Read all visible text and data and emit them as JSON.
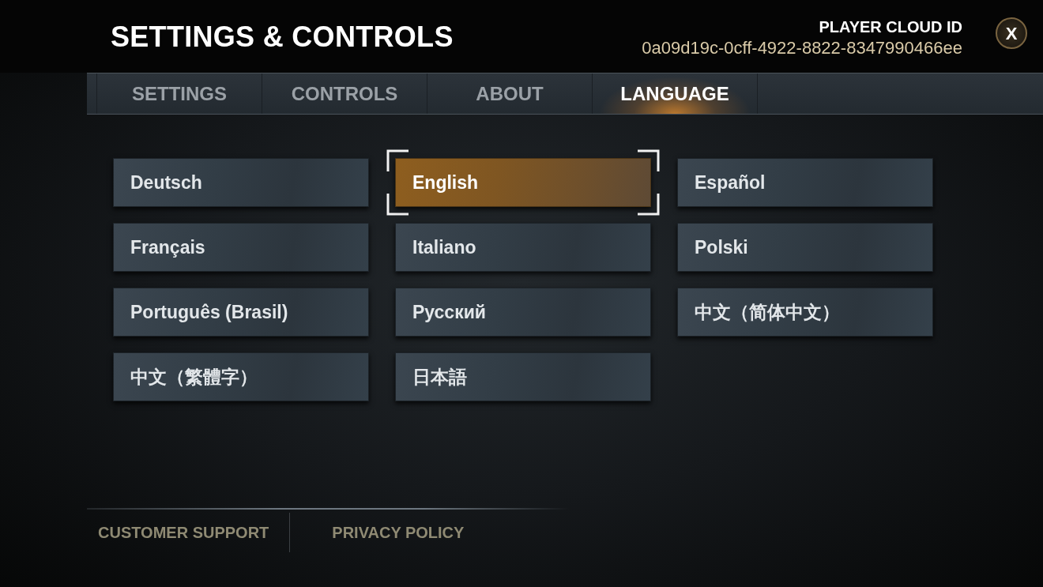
{
  "header": {
    "title": "SETTINGS & CONTROLS",
    "player_cloud_id": {
      "label": "PLAYER CLOUD ID",
      "value": "0a09d19c-0cff-4922-8822-8347990466ee"
    },
    "close_button": {
      "label": "X"
    }
  },
  "tabs": [
    {
      "label": "SETTINGS",
      "selected": false
    },
    {
      "label": "CONTROLS",
      "selected": false
    },
    {
      "label": "ABOUT",
      "selected": false
    },
    {
      "label": "LANGUAGE",
      "selected": true
    }
  ],
  "languages": [
    {
      "label": "Deutsch",
      "selected": false
    },
    {
      "label": "English",
      "selected": true
    },
    {
      "label": "Español",
      "selected": false
    },
    {
      "label": "Français",
      "selected": false
    },
    {
      "label": "Italiano",
      "selected": false
    },
    {
      "label": "Polski",
      "selected": false
    },
    {
      "label": "Português (Brasil)",
      "selected": false
    },
    {
      "label": "Русский",
      "selected": false
    },
    {
      "label": "中文（简体中文）",
      "selected": false
    },
    {
      "label": "中文（繁體字）",
      "selected": false
    },
    {
      "label": "日本語",
      "selected": false
    }
  ],
  "footer_links": [
    "CUSTOMER SUPPORT",
    "PRIVACY POLICY"
  ]
}
